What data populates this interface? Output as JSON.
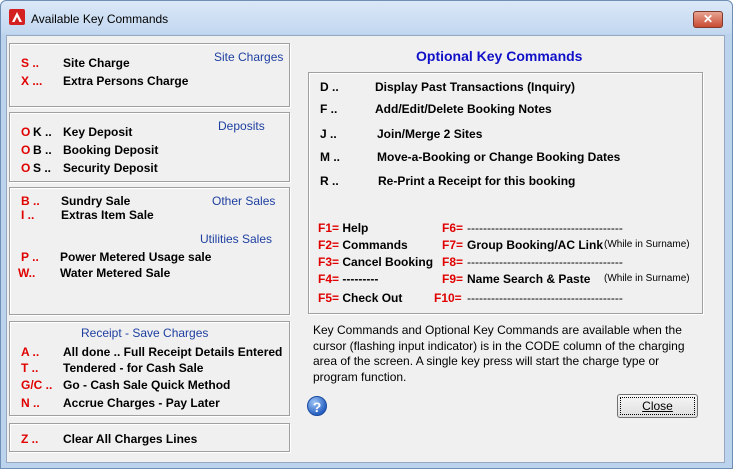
{
  "window": {
    "title": "Available Key Commands",
    "close_glyph": "✕"
  },
  "groups": {
    "site": {
      "heading": "Site Charges",
      "items": [
        {
          "key": "S ..",
          "label": "Site Charge"
        },
        {
          "key": "X ...",
          "label": "Extra Persons Charge"
        }
      ]
    },
    "deposits": {
      "heading": "Deposits",
      "items": [
        {
          "key": "O",
          "key2": "K ..",
          "label": "Key Deposit"
        },
        {
          "key": "O",
          "key2": "B ..",
          "label": "Booking Deposit"
        },
        {
          "key": "O",
          "key2": "S ..",
          "label": "Security Deposit"
        }
      ]
    },
    "other": {
      "heading": "Other Sales",
      "items": [
        {
          "key": "B ..",
          "label": "Sundry Sale"
        },
        {
          "key": "I ..",
          "label": "Extras Item Sale"
        }
      ]
    },
    "utilities": {
      "heading": "Utilities Sales",
      "items": [
        {
          "key": "P ..",
          "label": "Power Metered Usage sale"
        },
        {
          "key": "W..",
          "label": "Water Metered Sale"
        }
      ]
    },
    "receipt": {
      "heading": "Receipt - Save Charges",
      "items": [
        {
          "key": "A ..",
          "label": "All done .. Full Receipt Details Entered"
        },
        {
          "key": "T ..",
          "label": "Tendered - for Cash Sale"
        },
        {
          "key": "G/C ..",
          "label": "Go - Cash Sale Quick Method"
        },
        {
          "key": "N ..",
          "label": "Accrue Charges - Pay Later"
        }
      ]
    },
    "clear": {
      "items": [
        {
          "key": "Z ..",
          "label": "Clear All Charges Lines"
        }
      ]
    }
  },
  "optional": {
    "heading": "Optional Key Commands",
    "commands": [
      {
        "key": "D ..",
        "label": "Display Past Transactions (Inquiry)"
      },
      {
        "key": "F ..",
        "label": "Add/Edit/Delete Booking Notes"
      },
      {
        "key": "J ..",
        "label": "Join/Merge 2 Sites"
      },
      {
        "key": "M ..",
        "label": "Move-a-Booking or Change Booking Dates"
      },
      {
        "key": "R ..",
        "label": "Re-Print a Receipt for this booking"
      }
    ],
    "fkeys_left": [
      {
        "key": "F1=",
        "label": "Help"
      },
      {
        "key": "F2=",
        "label": "Commands"
      },
      {
        "key": "F3=",
        "label": "Cancel Booking"
      },
      {
        "key": "F4=",
        "label": "---------"
      },
      {
        "key": "F5=",
        "label": "Check Out"
      }
    ],
    "fkeys_right": [
      {
        "key": "F6=",
        "label": "---------------------------------------",
        "note": ""
      },
      {
        "key": "F7=",
        "label": "Group Booking/AC Link",
        "note": "(While in Surname)"
      },
      {
        "key": "F8=",
        "label": "---------------------------------------",
        "note": ""
      },
      {
        "key": "F9=",
        "label": "Name Search & Paste",
        "note": "(While in Surname)"
      },
      {
        "key": "F10=",
        "label": "---------------------------------------",
        "note": ""
      }
    ]
  },
  "description": "Key Commands and Optional Key Commands are available when the cursor (flashing input indicator) is in the CODE column of the charging area of the screen. A single key press will start the charge type or program function.",
  "buttons": {
    "help_glyph": "?",
    "close_label": "Close"
  },
  "colors": {
    "key_red": "#e00000",
    "heading_blue": "#1010c8",
    "section_blue": "#1e3fa0"
  }
}
